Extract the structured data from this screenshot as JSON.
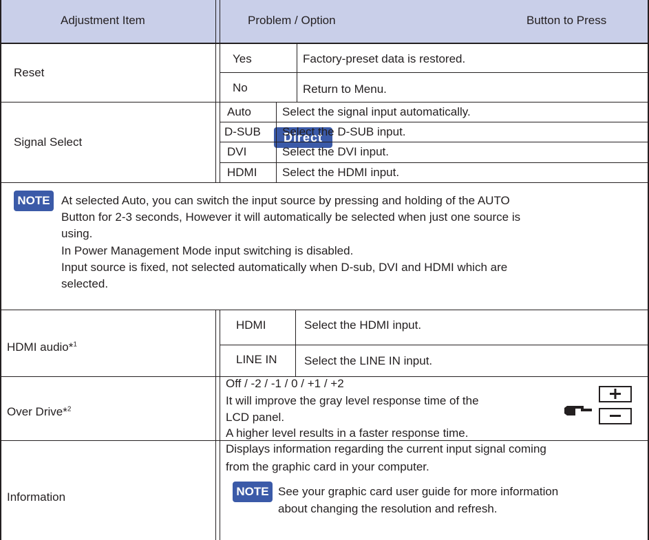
{
  "header": {
    "col1": "Adjustment Item",
    "col2": "Problem / Option",
    "col3": "Button to Press"
  },
  "rows": {
    "reset": {
      "item": "Reset",
      "yes_option": "Yes",
      "yes_desc": "Factory-preset data is restored.",
      "no_option": "No",
      "no_desc": "Return to Menu."
    },
    "signal_select": {
      "item": "Signal Select",
      "badge": "Direct",
      "options": [
        {
          "option": "Auto",
          "desc": "Select the signal input automatically."
        },
        {
          "option": "D-SUB",
          "desc": "Select the D-SUB input."
        },
        {
          "option": "DVI",
          "desc": "Select the DVI input."
        },
        {
          "option": "HDMI",
          "desc": "Select the HDMI input."
        }
      ]
    },
    "note": {
      "badge": "NOTE",
      "lines": [
        "At selected Auto, you can switch the input source by pressing and holding of the AUTO",
        "Button for 2-3 seconds, However it will automatically be selected when just one source is",
        "using.",
        "In Power Management Mode input switching is disabled.",
        "Input source is fixed, not selected automatically when D-sub, DVI and HDMI which are",
        "selected."
      ]
    },
    "hdmi_audio": {
      "item": "HDMI audio*",
      "footnote": "1",
      "hdmi_option": "HDMI",
      "hdmi_desc": "Select the HDMI input.",
      "linein_option": "LINE IN",
      "linein_desc": "Select the LINE IN input."
    },
    "over_drive": {
      "item": "Over Drive*",
      "footnote": "2",
      "lines": [
        "Off / -2 / -1 / 0 / +1 / +2",
        "It will improve the gray level response time of the",
        "LCD panel.",
        "A higher level results in a faster response time."
      ],
      "hand_icon": "pointing-hand-icon",
      "plus_icon": "plus-button-icon",
      "minus_icon": "minus-button-icon"
    },
    "information": {
      "item": "Information",
      "lines": [
        "Displays information regarding the current input signal coming",
        "from the graphic card in your computer."
      ],
      "note_badge": "NOTE",
      "note_lines": [
        "See your graphic card user guide for more information",
        "about changing the resolution and refresh."
      ]
    }
  },
  "colors": {
    "header_bg": "#c9cfe9",
    "badge_bg": "#3b5aa8",
    "text": "#231f20"
  }
}
